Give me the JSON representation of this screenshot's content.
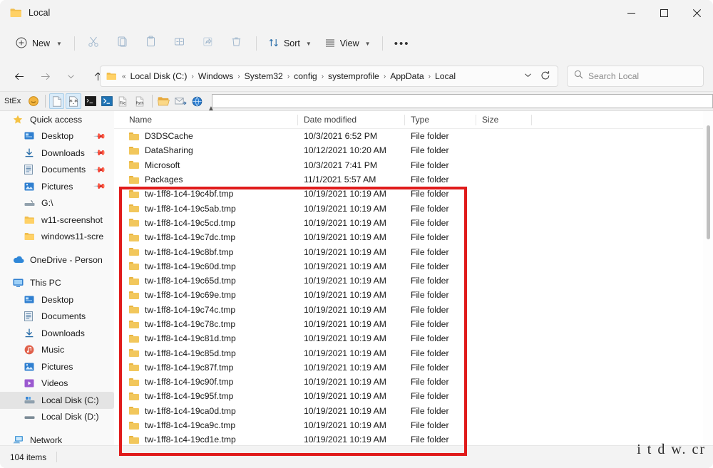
{
  "window": {
    "title": "Local",
    "icon": "folder-icon",
    "controls": {
      "minimize": "─",
      "maximize": "□",
      "close": "✕"
    }
  },
  "command_bar": {
    "new_label": "New",
    "new_icon": "plus-circle-icon",
    "icon_buttons": [
      {
        "name": "cut-button",
        "icon": "scissors-icon"
      },
      {
        "name": "copy-button",
        "icon": "copy-icon"
      },
      {
        "name": "paste-button",
        "icon": "clipboard-icon"
      },
      {
        "name": "rename-button",
        "icon": "rename-icon"
      },
      {
        "name": "share-button",
        "icon": "share-icon"
      },
      {
        "name": "delete-button",
        "icon": "trash-icon"
      }
    ],
    "sort_label": "Sort",
    "sort_icon": "sort-arrows-icon",
    "view_label": "View",
    "view_icon": "view-lines-icon",
    "overflow_label": "•••"
  },
  "address_bar": {
    "back_icon": "arrow-left-icon",
    "forward_icon": "arrow-right-icon",
    "recent_icon": "chevron-down-icon",
    "up_icon": "arrow-up-icon",
    "folder_icon": "folder-icon",
    "overflow_crumb": "«",
    "breadcrumbs": [
      "Local Disk (C:)",
      "Windows",
      "System32",
      "config",
      "systemprofile",
      "AppData",
      "Local"
    ],
    "separator": "›",
    "dropdown_icon": "chevron-down-icon",
    "refresh_icon": "refresh-icon"
  },
  "search": {
    "placeholder": "Search Local",
    "icon": "search-icon"
  },
  "stex_toolbar": {
    "label": "StEx",
    "buttons": [
      {
        "name": "stex-coin-icon",
        "icon": "coin-icon",
        "selected": false
      },
      {
        "name": "stex-newfile-icon",
        "icon": "blank-page-icon",
        "selected": true
      },
      {
        "name": "stex-wildcard-icon",
        "icon": "asterisk-page-icon",
        "selected": true
      },
      {
        "name": "stex-console-icon",
        "icon": "command-prompt-icon",
        "selected": false
      },
      {
        "name": "stex-powershell-icon",
        "icon": "powershell-icon",
        "selected": false
      },
      {
        "name": "stex-copyfile-icon",
        "icon": "copy-file-name-icon",
        "selected": false
      },
      {
        "name": "stex-copypath-icon",
        "icon": "copy-path-icon",
        "selected": false
      },
      {
        "name": "stex-openfolder-icon",
        "icon": "open-folder-icon",
        "selected": false
      },
      {
        "name": "stex-mailto-icon",
        "icon": "mail-send-icon",
        "selected": false
      },
      {
        "name": "stex-browser-icon",
        "icon": "globe-icon",
        "selected": false
      }
    ],
    "input_value": ""
  },
  "sidebar": {
    "groups": [
      {
        "header": {
          "label": "Quick access",
          "icon": "star-icon"
        },
        "items": [
          {
            "label": "Desktop",
            "icon": "desktop-icon",
            "pinned": true
          },
          {
            "label": "Downloads",
            "icon": "download-icon",
            "pinned": true
          },
          {
            "label": "Documents",
            "icon": "documents-icon",
            "pinned": true
          },
          {
            "label": "Pictures",
            "icon": "pictures-icon",
            "pinned": true
          },
          {
            "label": "G:\\",
            "icon": "drive-icon",
            "pinned": false
          },
          {
            "label": "w11-screenshot",
            "icon": "folder-icon",
            "pinned": false
          },
          {
            "label": "windows11-scre",
            "icon": "folder-icon",
            "pinned": false
          }
        ]
      },
      {
        "header": {
          "label": "OneDrive - Person",
          "icon": "cloud-icon"
        },
        "items": []
      },
      {
        "header": {
          "label": "This PC",
          "icon": "monitor-icon"
        },
        "items": [
          {
            "label": "Desktop",
            "icon": "desktop-icon",
            "pinned": false
          },
          {
            "label": "Documents",
            "icon": "documents-icon",
            "pinned": false
          },
          {
            "label": "Downloads",
            "icon": "download-icon",
            "pinned": false
          },
          {
            "label": "Music",
            "icon": "music-icon",
            "pinned": false
          },
          {
            "label": "Pictures",
            "icon": "pictures-icon",
            "pinned": false
          },
          {
            "label": "Videos",
            "icon": "videos-icon",
            "pinned": false
          },
          {
            "label": "Local Disk (C:)",
            "icon": "hard-drive-icon",
            "pinned": false,
            "active": true
          },
          {
            "label": "Local Disk (D:)",
            "icon": "hard-drive-icon",
            "pinned": false
          }
        ]
      },
      {
        "header": {
          "label": "Network",
          "icon": "network-icon"
        },
        "items": []
      }
    ]
  },
  "file_list": {
    "columns": [
      "Name",
      "Date modified",
      "Type",
      "Size"
    ],
    "sort_column": "Name",
    "sort_direction": "ascending",
    "rows": [
      {
        "name": "D3DSCache",
        "date": "10/3/2021 6:52 PM",
        "type": "File folder",
        "size": ""
      },
      {
        "name": "DataSharing",
        "date": "10/12/2021 10:20 AM",
        "type": "File folder",
        "size": ""
      },
      {
        "name": "Microsoft",
        "date": "10/3/2021 7:41 PM",
        "type": "File folder",
        "size": ""
      },
      {
        "name": "Packages",
        "date": "11/1/2021 5:57 AM",
        "type": "File folder",
        "size": ""
      },
      {
        "name": "tw-1ff8-1c4-19c4bf.tmp",
        "date": "10/19/2021 10:19 AM",
        "type": "File folder",
        "size": ""
      },
      {
        "name": "tw-1ff8-1c4-19c5ab.tmp",
        "date": "10/19/2021 10:19 AM",
        "type": "File folder",
        "size": ""
      },
      {
        "name": "tw-1ff8-1c4-19c5cd.tmp",
        "date": "10/19/2021 10:19 AM",
        "type": "File folder",
        "size": ""
      },
      {
        "name": "tw-1ff8-1c4-19c7dc.tmp",
        "date": "10/19/2021 10:19 AM",
        "type": "File folder",
        "size": ""
      },
      {
        "name": "tw-1ff8-1c4-19c8bf.tmp",
        "date": "10/19/2021 10:19 AM",
        "type": "File folder",
        "size": ""
      },
      {
        "name": "tw-1ff8-1c4-19c60d.tmp",
        "date": "10/19/2021 10:19 AM",
        "type": "File folder",
        "size": ""
      },
      {
        "name": "tw-1ff8-1c4-19c65d.tmp",
        "date": "10/19/2021 10:19 AM",
        "type": "File folder",
        "size": ""
      },
      {
        "name": "tw-1ff8-1c4-19c69e.tmp",
        "date": "10/19/2021 10:19 AM",
        "type": "File folder",
        "size": ""
      },
      {
        "name": "tw-1ff8-1c4-19c74c.tmp",
        "date": "10/19/2021 10:19 AM",
        "type": "File folder",
        "size": ""
      },
      {
        "name": "tw-1ff8-1c4-19c78c.tmp",
        "date": "10/19/2021 10:19 AM",
        "type": "File folder",
        "size": ""
      },
      {
        "name": "tw-1ff8-1c4-19c81d.tmp",
        "date": "10/19/2021 10:19 AM",
        "type": "File folder",
        "size": ""
      },
      {
        "name": "tw-1ff8-1c4-19c85d.tmp",
        "date": "10/19/2021 10:19 AM",
        "type": "File folder",
        "size": ""
      },
      {
        "name": "tw-1ff8-1c4-19c87f.tmp",
        "date": "10/19/2021 10:19 AM",
        "type": "File folder",
        "size": ""
      },
      {
        "name": "tw-1ff8-1c4-19c90f.tmp",
        "date": "10/19/2021 10:19 AM",
        "type": "File folder",
        "size": ""
      },
      {
        "name": "tw-1ff8-1c4-19c95f.tmp",
        "date": "10/19/2021 10:19 AM",
        "type": "File folder",
        "size": ""
      },
      {
        "name": "tw-1ff8-1c4-19ca0d.tmp",
        "date": "10/19/2021 10:19 AM",
        "type": "File folder",
        "size": ""
      },
      {
        "name": "tw-1ff8-1c4-19ca9c.tmp",
        "date": "10/19/2021 10:19 AM",
        "type": "File folder",
        "size": ""
      },
      {
        "name": "tw-1ff8-1c4-19cd1e.tmp",
        "date": "10/19/2021 10:19 AM",
        "type": "File folder",
        "size": ""
      }
    ]
  },
  "annotation": {
    "color": "#e01b1b",
    "description": "red highlight rectangle around tmp folders"
  },
  "status_bar": {
    "item_count": "104 items"
  },
  "watermark": {
    "text": "i t d w. cr"
  }
}
